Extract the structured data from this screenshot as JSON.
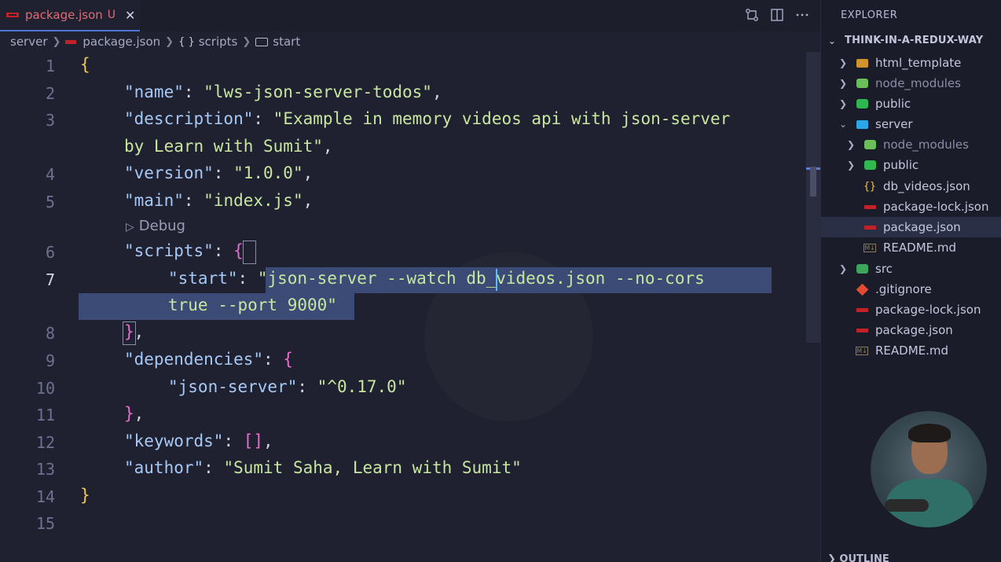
{
  "tab": {
    "label": "package.json",
    "status": "U"
  },
  "breadcrumb": {
    "folder": "server",
    "file": "package.json",
    "scripts": "scripts",
    "start": "start"
  },
  "code": {
    "lines": [
      {
        "num": "1"
      },
      {
        "num": "2"
      },
      {
        "num": "3"
      },
      {
        "num": "4"
      },
      {
        "num": "5"
      },
      {
        "num": "6"
      },
      {
        "num": "7"
      },
      {
        "num": "8"
      },
      {
        "num": "9"
      },
      {
        "num": "10"
      },
      {
        "num": "11"
      },
      {
        "num": "12"
      },
      {
        "num": "13"
      },
      {
        "num": "14"
      },
      {
        "num": "15"
      }
    ],
    "text": {
      "open_brace": "{",
      "name_key": "\"name\"",
      "name_val": "\"lws-json-server-todos\"",
      "desc_key": "\"description\"",
      "desc_val_1": "\"Example in memory videos api with json-server",
      "desc_val_2": "by Learn with Sumit\"",
      "version_key": "\"version\"",
      "version_val": "\"1.0.0\"",
      "main_key": "\"main\"",
      "main_val": "\"index.js\"",
      "debug": "Debug",
      "scripts_key": "\"scripts\"",
      "start_key": "\"start\"",
      "start_val_1": "\"json-server --watch db_videos.json --no-cors",
      "start_val_2": "true --port 9000\"",
      "close_scripts": "}",
      "deps_key": "\"dependencies\"",
      "jsonserver_key": "\"json-server\"",
      "jsonserver_val": "\"^0.17.0\"",
      "keywords_key": "\"keywords\"",
      "keywords_val": "[]",
      "author_key": "\"author\"",
      "author_val": "\"Sumit Saha, Learn with Sumit\"",
      "close_brace": "}"
    }
  },
  "explorer": {
    "title": "EXPLORER",
    "project": "THINK-IN-A-REDUX-WAY",
    "items": [
      {
        "label": "html_template"
      },
      {
        "label": "node_modules"
      },
      {
        "label": "public"
      },
      {
        "label": "server"
      },
      {
        "label": "node_modules"
      },
      {
        "label": "public"
      },
      {
        "label": "db_videos.json"
      },
      {
        "label": "package-lock.json"
      },
      {
        "label": "package.json"
      },
      {
        "label": "README.md"
      },
      {
        "label": "src"
      },
      {
        "label": ".gitignore"
      },
      {
        "label": "package-lock.json"
      },
      {
        "label": "package.json"
      },
      {
        "label": "README.md"
      }
    ],
    "outline": "OUTLINE"
  },
  "colors": {
    "accent": "#4f73d6",
    "selection": "#3c4b75",
    "background": "#1f2130",
    "sidebar": "#1a1c2a"
  }
}
